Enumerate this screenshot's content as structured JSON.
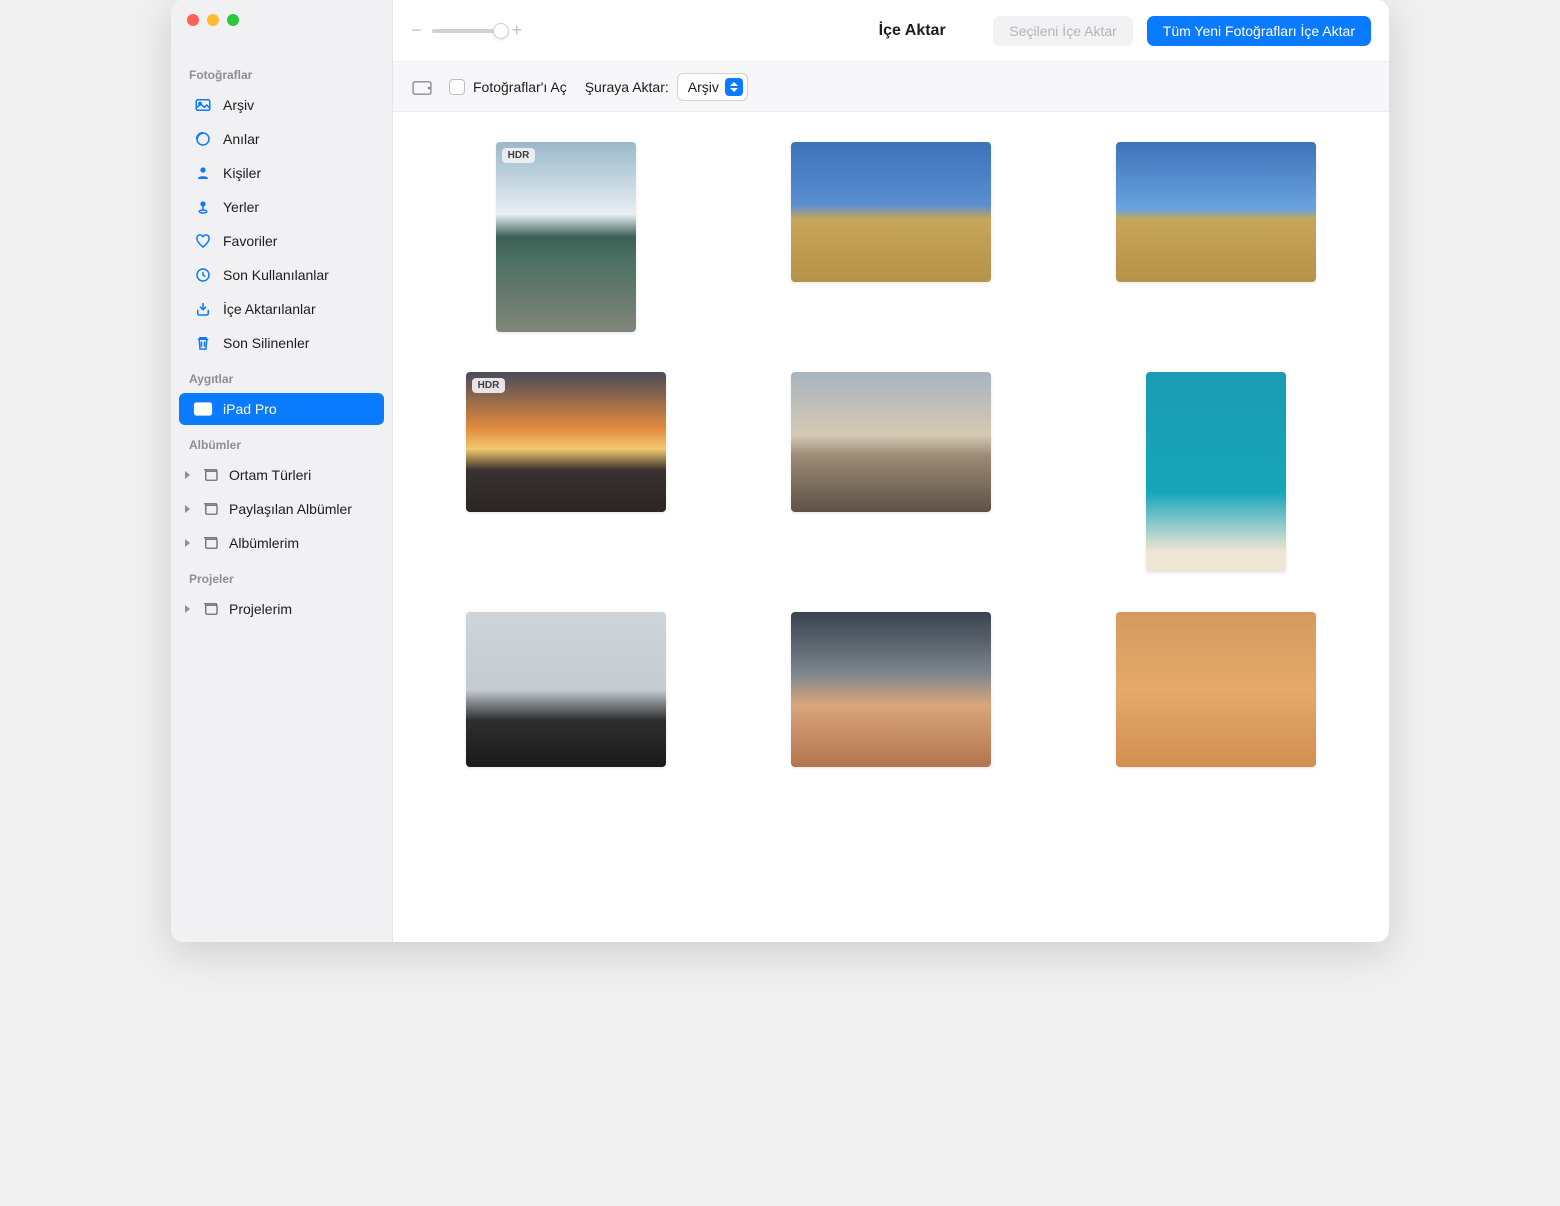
{
  "sidebar": {
    "sections": {
      "photos": {
        "header": "Fotoğraflar",
        "items": [
          {
            "label": "Arşiv"
          },
          {
            "label": "Anılar"
          },
          {
            "label": "Kişiler"
          },
          {
            "label": "Yerler"
          },
          {
            "label": "Favoriler"
          },
          {
            "label": "Son Kullanılanlar"
          },
          {
            "label": "İçe Aktarılanlar"
          },
          {
            "label": "Son Silinenler"
          }
        ]
      },
      "devices": {
        "header": "Aygıtlar",
        "items": [
          {
            "label": "iPad Pro"
          }
        ]
      },
      "albums": {
        "header": "Albümler",
        "items": [
          {
            "label": "Ortam Türleri"
          },
          {
            "label": "Paylaşılan Albümler"
          },
          {
            "label": "Albümlerim"
          }
        ]
      },
      "projects": {
        "header": "Projeler",
        "items": [
          {
            "label": "Projelerim"
          }
        ]
      }
    }
  },
  "toolbar": {
    "title": "İçe Aktar",
    "import_selected_label": "Seçileni İçe Aktar",
    "import_all_label": "Tüm Yeni Fotoğrafları İçe Aktar"
  },
  "subbar": {
    "open_photos_label": "Fotoğraflar'ı Aç",
    "transfer_to_label": "Şuraya Aktar:",
    "transfer_target": "Arşiv"
  },
  "grid": {
    "hdr_badge": "HDR"
  }
}
